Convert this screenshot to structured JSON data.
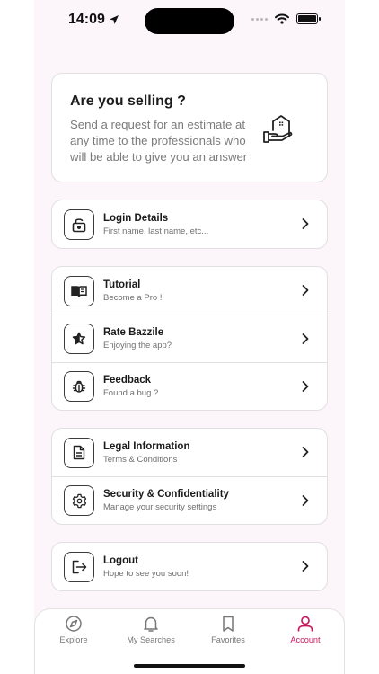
{
  "status_bar": {
    "time": "14:09"
  },
  "sell_card": {
    "title": "Are you selling ?",
    "text": "Send a request for an estimate at any time to the professionals who will be able to give you an answer",
    "icon": "house-hand-icon"
  },
  "groups": [
    [
      {
        "title": "Login Details",
        "subtitle": "First name, last name, etc...",
        "icon": "lock-icon"
      }
    ],
    [
      {
        "title": "Tutorial",
        "subtitle": "Become a Pro !",
        "icon": "book-icon"
      },
      {
        "title": "Rate Bazzile",
        "subtitle": "Enjoying the app?",
        "icon": "star-icon"
      },
      {
        "title": "Feedback",
        "subtitle": "Found a bug ?",
        "icon": "bug-icon"
      }
    ],
    [
      {
        "title": "Legal Information",
        "subtitle": "Terms & Conditions",
        "icon": "document-icon"
      },
      {
        "title": "Security & Confidentiality",
        "subtitle": "Manage your security settings",
        "icon": "gear-icon"
      }
    ],
    [
      {
        "title": "Logout",
        "subtitle": "Hope to see you soon!",
        "icon": "logout-icon"
      }
    ]
  ],
  "tabs": [
    {
      "label": "Explore",
      "icon": "compass-icon",
      "active": false
    },
    {
      "label": "My Searches",
      "icon": "bell-icon",
      "active": false
    },
    {
      "label": "Favorites",
      "icon": "bookmark-icon",
      "active": false
    },
    {
      "label": "Account",
      "icon": "person-icon",
      "active": true
    }
  ],
  "colors": {
    "accent": "#c8185f",
    "background": "#fcf5f9",
    "card": "#ffffff"
  }
}
